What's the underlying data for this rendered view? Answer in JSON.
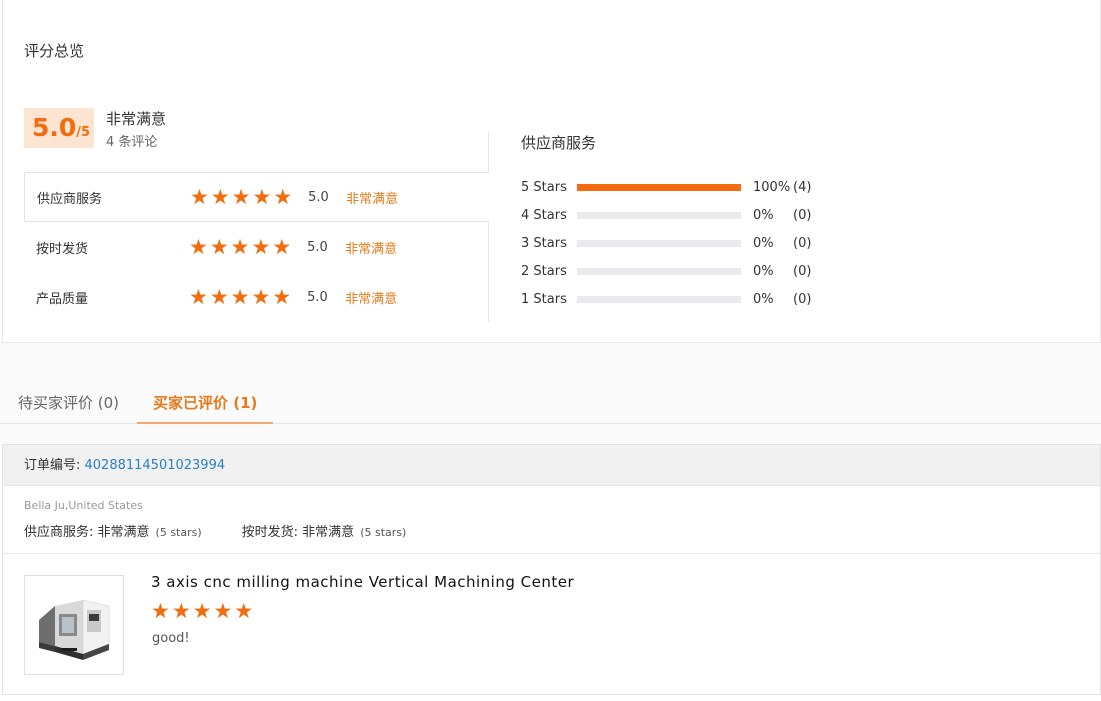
{
  "summary": {
    "title": "评分总览",
    "score_main": "5.0",
    "score_denom": "/5",
    "score_label": "非常满意",
    "review_count": "4 条评论",
    "ratings": [
      {
        "name": "供应商服务",
        "stars": 5,
        "value": "5.0",
        "desc": "非常满意"
      },
      {
        "name": "按时发货",
        "stars": 5,
        "value": "5.0",
        "desc": "非常满意"
      },
      {
        "name": "产品质量",
        "stars": 5,
        "value": "5.0",
        "desc": "非常满意"
      }
    ]
  },
  "distribution": {
    "title": "供应商服务",
    "rows": [
      {
        "label": "5  Stars",
        "fraction": 1.0,
        "percent": "100%",
        "count": "(4)"
      },
      {
        "label": "4  Stars",
        "fraction": 0,
        "percent": "0%",
        "count": "(0)"
      },
      {
        "label": "3  Stars",
        "fraction": 0,
        "percent": "0%",
        "count": "(0)"
      },
      {
        "label": "2  Stars",
        "fraction": 0,
        "percent": "0%",
        "count": "(0)"
      },
      {
        "label": "1  Stars",
        "fraction": 0,
        "percent": "0%",
        "count": "(0)"
      }
    ]
  },
  "tabs": {
    "pending": "待买家评价 (0)",
    "done": "买家已评价 (1)"
  },
  "review": {
    "order_label": "订单编号: ",
    "order_number": "40288114501023994",
    "buyer": "Bella Ju,United States",
    "aspects": [
      {
        "label": "供应商服务: ",
        "value": "非常满意",
        "stars": "(5 stars)"
      },
      {
        "label": "按时发货: ",
        "value": "非常满意",
        "stars": "(5 stars)"
      }
    ],
    "product_title": "3 axis cnc milling machine Vertical Machining Center",
    "stars": 5,
    "text": "good!"
  },
  "colors": {
    "accent": "#f36d0f",
    "link": "#2a82c6"
  },
  "icons": {
    "star": "star-icon",
    "product": "cnc-machine-thumbnail"
  }
}
